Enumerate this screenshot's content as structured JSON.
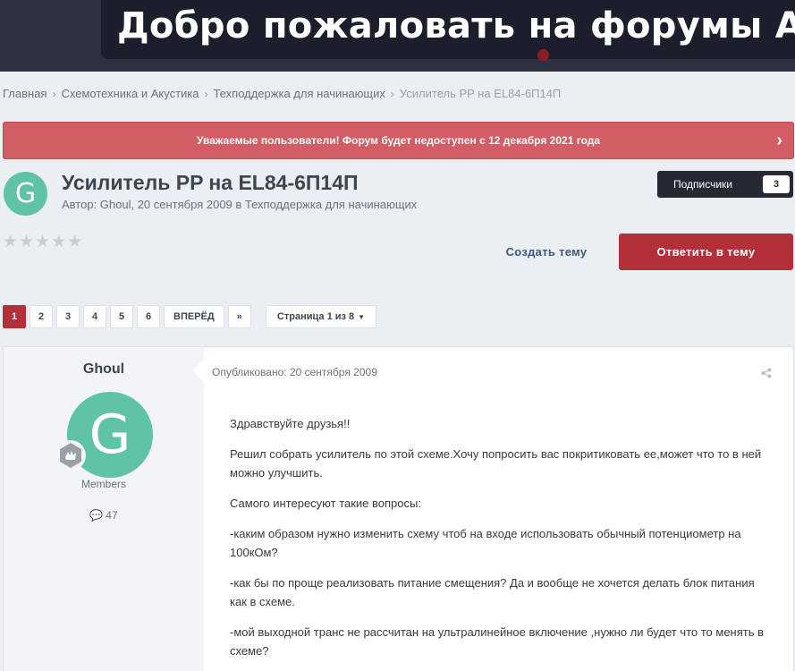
{
  "header": {
    "banner_text": "Добро пожаловать на форумы Аудио",
    "bg_color": "#2d3141",
    "banner_color": "#1c1e2b"
  },
  "breadcrumb": {
    "items": [
      "Главная",
      "Схемотехника и Акустика",
      "Техподдержка для начинающих",
      "Усилитель PP на EL84-6П14П"
    ]
  },
  "announcement": {
    "text": "Уважаемые пользователи! Форум будет недоступен с 12 декабря 2021 года",
    "color": "#d25d64"
  },
  "topic": {
    "avatar_letter": "G",
    "title": "Усилитель PP на EL84-6П14П",
    "meta": "Автор: Ghoul, 20 сентября 2009 в Техподдержка для начинающих",
    "rating_stars": 5,
    "rating_value": 0,
    "subscribers_label": "Подписчики",
    "subscribers_count": "3",
    "create_topic_label": "Создать тему",
    "reply_label": "Ответить в тему",
    "accent_color": "#b3303a"
  },
  "pagination": {
    "pages": [
      "1",
      "2",
      "3",
      "4",
      "5",
      "6"
    ],
    "current": "1",
    "next_label": "ВПЕРЁД",
    "last_label": "»",
    "page_of_label": "Страница 1 из 8"
  },
  "post": {
    "author": "Ghoul",
    "avatar_letter": "G",
    "group": "Members",
    "post_count": "47",
    "date": "Опубликовано: 20 сентября 2009",
    "paragraphs": [
      "Здравствуйте друзья!!",
      "Решил собрать усилитель по этой схеме.Хочу попросить вас покритиковать ее,может что то в ней можно улучшить.",
      "Самого интересуют такие вопросы:",
      "-каким образом нужно изменить схему чтоб на входе использовать обычный потенциометр на 100кОм?",
      "-как бы по проще реализовать питание смещения? Да и вообще не хочется делать блок питания как в схеме.",
      "-мой выходной транс не рассчитан на ультралинейное включение ,нужно ли будет что то менять в схеме?"
    ]
  },
  "icons": {
    "announce": "chevron-right-icon",
    "star": "star-icon",
    "menu": "caret-down-icon",
    "badge": "rank-badge-icon",
    "posts": "speech-bubble-icon",
    "share": "share-icon"
  }
}
